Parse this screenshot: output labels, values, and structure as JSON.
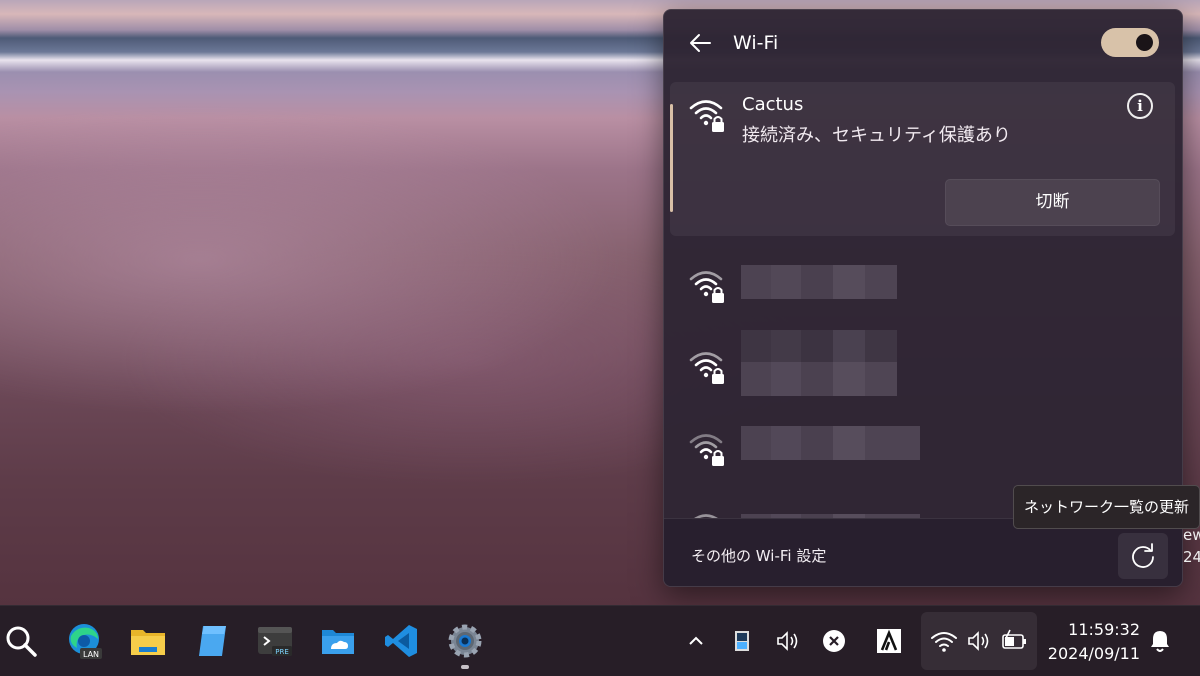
{
  "flyout": {
    "title": "Wi-Fi",
    "wifi_enabled": true,
    "connected": {
      "name": "Cactus",
      "status": "接続済み、セキュリティ保護あり",
      "disconnect_label": "切断"
    },
    "other_networks_count": 4,
    "footer": {
      "more_settings_label": "その他の Wi-Fi 設定"
    }
  },
  "tooltip": {
    "text": "ネットワーク一覧の更新"
  },
  "desktop_fragments": {
    "line1": "ew",
    "line2": "24"
  },
  "taskbar": {
    "apps": [
      "search-icon",
      "edge-icon",
      "file-explorer-icon",
      "notepad-icon",
      "terminal-preview-icon",
      "onedrive-folder-icon",
      "vscode-icon",
      "settings-icon"
    ],
    "edge_badge": "LAN",
    "terminal_badge": "PRE",
    "tray_icons": [
      "chevron-up-icon",
      "storage-icon",
      "volume-icon",
      "close-circle-icon",
      "adobe-icon",
      "wifi-icon",
      "volume-icon",
      "battery-charging-icon"
    ],
    "clock": {
      "time": "11:59:32",
      "date": "2024/09/11"
    }
  },
  "colors": {
    "accent": "#d9c0a7",
    "flyout_bg": "#2e2534",
    "taskbar_bg": "#271e27"
  }
}
